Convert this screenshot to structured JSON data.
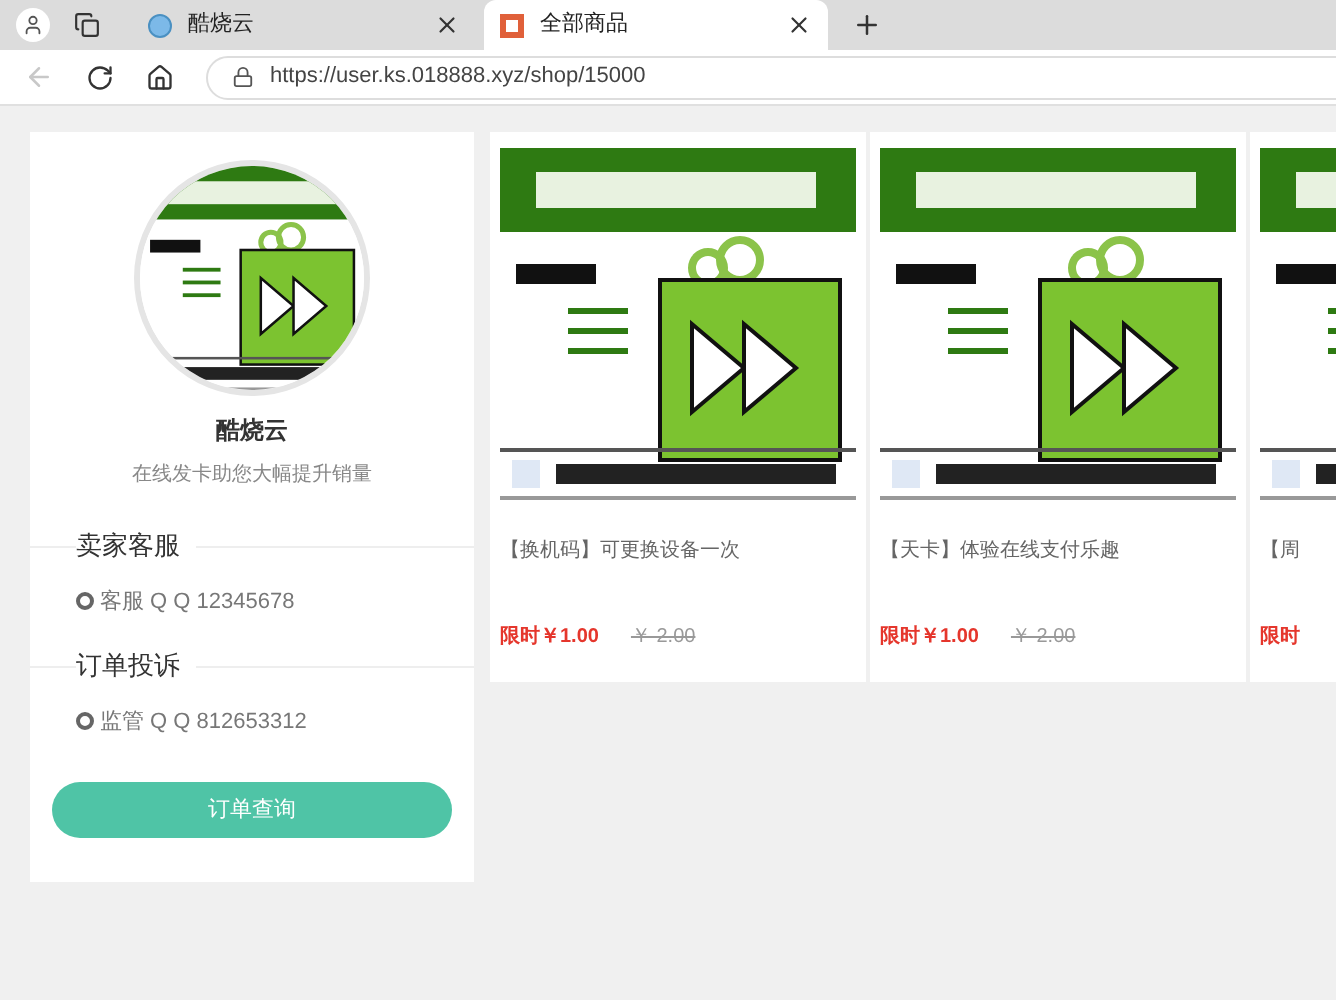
{
  "browser": {
    "tabs": [
      {
        "title": "酷烧云",
        "selected": false,
        "kind": "site"
      },
      {
        "title": "全部商品",
        "selected": true,
        "kind": "shop"
      }
    ],
    "url": "https://user.ks.018888.xyz/shop/15000"
  },
  "sidebar": {
    "shop_name": "酷烧云",
    "slogan": "在线发卡助您大幅提升销量",
    "sections": [
      {
        "title": "卖家客服",
        "contact": "客服 Q Q 12345678"
      },
      {
        "title": "订单投诉",
        "contact": "监管 Q Q 812653312"
      }
    ],
    "button": "订单查询"
  },
  "products": [
    {
      "title": "【换机码】可更换设备一次",
      "price": "限时￥1.00",
      "original_price": "￥ 2.00"
    },
    {
      "title": "【天卡】体验在线支付乐趣",
      "price": "限时￥1.00",
      "original_price": "￥ 2.00"
    },
    {
      "title": "【周",
      "price": "限时"
    }
  ]
}
